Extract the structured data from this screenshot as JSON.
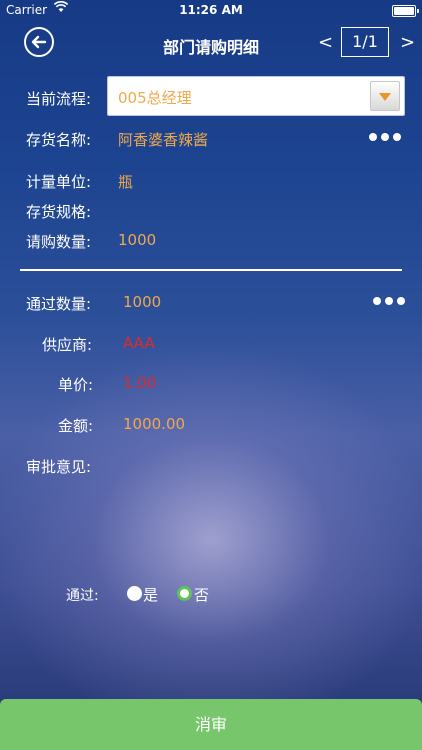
{
  "status_bar": {
    "carrier": "Carrier",
    "time": "11:26 AM"
  },
  "nav": {
    "title": "部门请购明细",
    "prev": "<",
    "page": "1/1",
    "next": ">"
  },
  "form": {
    "process_label": "当前流程:",
    "process_value": "005总经理",
    "item_name_label": "存货名称:",
    "item_name_value": "阿香婆香辣酱",
    "unit_label": "计量单位:",
    "unit_value": "瓶",
    "spec_label": "存货规格:",
    "spec_value": "",
    "request_qty_label": "请购数量:",
    "request_qty_value": "1000",
    "pass_qty_label": "通过数量:",
    "pass_qty_value": "1000",
    "supplier_label": "供应商:",
    "supplier_value": "AAA",
    "unit_price_label": "单价:",
    "unit_price_value": "1.00",
    "amount_label": "金额:",
    "amount_value": "1000.00",
    "opinion_label": "审批意见:"
  },
  "approval": {
    "label": "通过:",
    "options": [
      {
        "label": "是",
        "checked": false
      },
      {
        "label": "否",
        "checked": true
      }
    ]
  },
  "button": {
    "label": "消审"
  },
  "colors": {
    "value": "#f0a94a",
    "alert": "#e02a2a",
    "button": "#77c66b",
    "radio_check": "#5ec45a"
  }
}
